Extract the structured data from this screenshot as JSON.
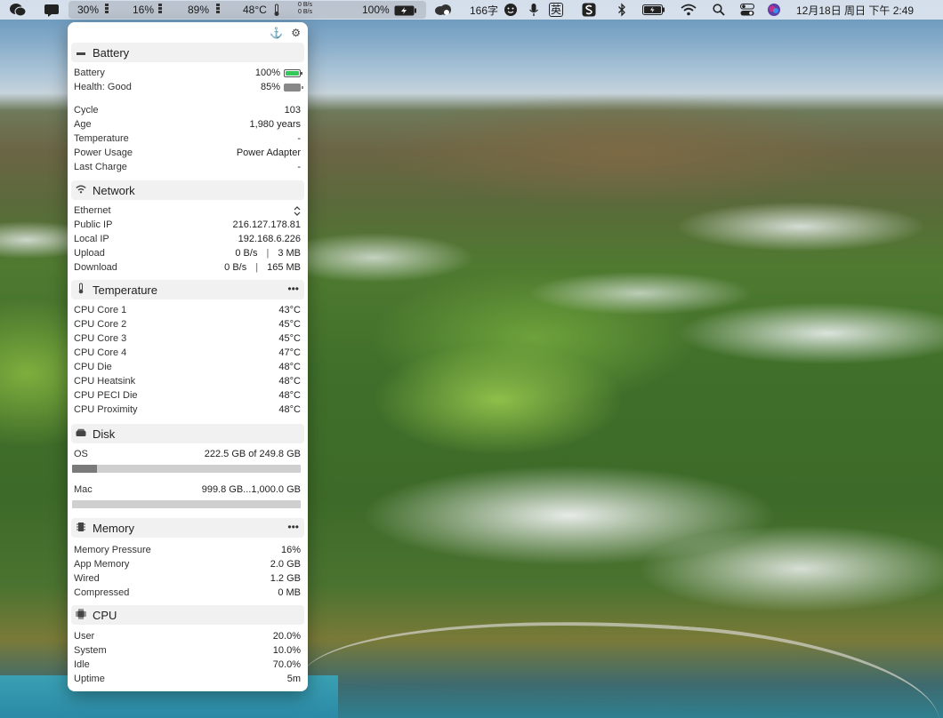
{
  "menubar": {
    "cpu_pct": "30%",
    "gpu_pct": "16%",
    "mem_pct": "89%",
    "temp": "48°C",
    "net_up": "0 B/s",
    "net_down": "0 B/s",
    "battery_pct": "100%",
    "word_count": "166字",
    "ime_label": "英",
    "date_time": "12月18日 周日 下午 2:49",
    "icons": [
      "wechat-icon",
      "chat-icon",
      "cloud-icon",
      "emoji-icon",
      "microphone-icon",
      "sogou-icon",
      "bluetooth-icon",
      "battery-icon",
      "wifi-icon",
      "search-icon",
      "control-center-icon",
      "siri-icon"
    ]
  },
  "panel": {
    "battery": {
      "title": "Battery",
      "battery_label": "Battery",
      "battery_value": "100%",
      "health_label": "Health: Good",
      "health_value": "85%",
      "cycle_label": "Cycle",
      "cycle_value": "103",
      "age_label": "Age",
      "age_value": "1,980 years",
      "temp_label": "Temperature",
      "temp_value": "-",
      "power_label": "Power Usage",
      "power_value": "Power Adapter",
      "last_label": "Last Charge",
      "last_value": "-",
      "level_fraction": 1.0,
      "health_fraction": 0.85,
      "fill_color": "#34c759"
    },
    "network": {
      "title": "Network",
      "iface_label": "Ethernet",
      "public_label": "Public IP",
      "public_value": "216.127.178.81",
      "local_label": "Local IP",
      "local_value": "192.168.6.226",
      "upload_label": "Upload",
      "upload_rate": "0 B/s",
      "upload_total": "3 MB",
      "download_label": "Download",
      "download_rate": "0 B/s",
      "download_total": "165 MB"
    },
    "temperature": {
      "title": "Temperature",
      "sensors": [
        {
          "name": "CPU Core 1",
          "value": "43°C"
        },
        {
          "name": "CPU Core 2",
          "value": "45°C"
        },
        {
          "name": "CPU Core 3",
          "value": "45°C"
        },
        {
          "name": "CPU Core 4",
          "value": "47°C"
        },
        {
          "name": "CPU Die",
          "value": "48°C"
        },
        {
          "name": "CPU Heatsink",
          "value": "48°C"
        },
        {
          "name": "CPU PECI Die",
          "value": "48°C"
        },
        {
          "name": "CPU Proximity",
          "value": "48°C"
        }
      ]
    },
    "disk": {
      "title": "Disk",
      "volumes": [
        {
          "name": "OS",
          "usage": "222.5 GB of 249.8 GB",
          "used_fraction": 0.11
        },
        {
          "name": "Mac",
          "usage": "999.8 GB...1,000.0 GB",
          "used_fraction": 0.0
        }
      ]
    },
    "memory": {
      "title": "Memory",
      "pressure_label": "Memory Pressure",
      "pressure_value": "16%",
      "app_label": "App Memory",
      "app_value": "2.0 GB",
      "wired_label": "Wired",
      "wired_value": "1.2 GB",
      "compressed_label": "Compressed",
      "compressed_value": "0 MB"
    },
    "cpu": {
      "title": "CPU",
      "user_label": "User",
      "user_value": "20.0%",
      "system_label": "System",
      "system_value": "10.0%",
      "idle_label": "Idle",
      "idle_value": "70.0%",
      "uptime_label": "Uptime",
      "uptime_value": "5m"
    }
  }
}
